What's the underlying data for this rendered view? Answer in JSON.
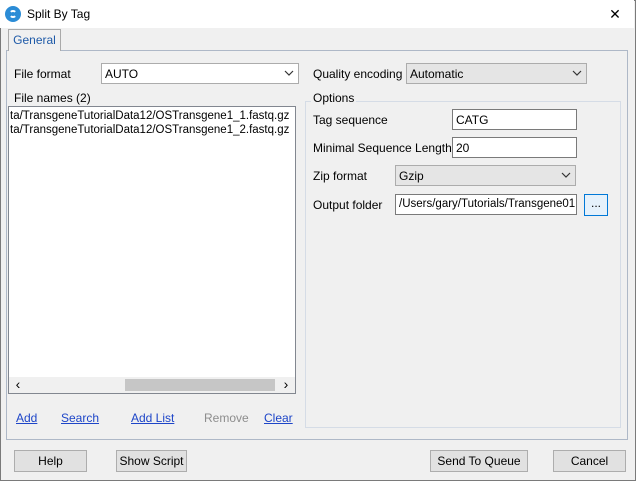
{
  "window": {
    "title": "Split By Tag",
    "close_glyph": "✕"
  },
  "tabs": [
    {
      "label": "General"
    }
  ],
  "file_format": {
    "label": "File format",
    "value": "AUTO"
  },
  "quality_encoding": {
    "label": "Quality encoding",
    "value": "Automatic"
  },
  "file_names": {
    "label": "File names (2)",
    "items": [
      "ta/TransgeneTutorialData12/OSTransgene1_1.fastq.gz",
      "ta/TransgeneTutorialData12/OSTransgene1_2.fastq.gz"
    ],
    "scroll_left": "‹",
    "scroll_right": "›"
  },
  "list_actions": {
    "add": "Add",
    "search": "Search",
    "add_list": "Add List",
    "remove": "Remove",
    "clear": "Clear"
  },
  "options": {
    "title": "Options",
    "tag_sequence": {
      "label": "Tag sequence",
      "value": "CATG"
    },
    "min_length": {
      "label": "Minimal Sequence Length",
      "value": "20"
    },
    "zip_format": {
      "label": "Zip format",
      "value": "Gzip"
    },
    "output_folder": {
      "label": "Output folder",
      "value": "/Users/gary/Tutorials/Transgene01"
    },
    "browse_label": "..."
  },
  "buttons": {
    "help": "Help",
    "show_script": "Show Script",
    "send_to_queue": "Send To Queue",
    "cancel": "Cancel"
  },
  "icons": [
    "app-icon",
    "close-icon",
    "chevron-down-icon",
    "scroll-left-icon",
    "scroll-right-icon"
  ]
}
